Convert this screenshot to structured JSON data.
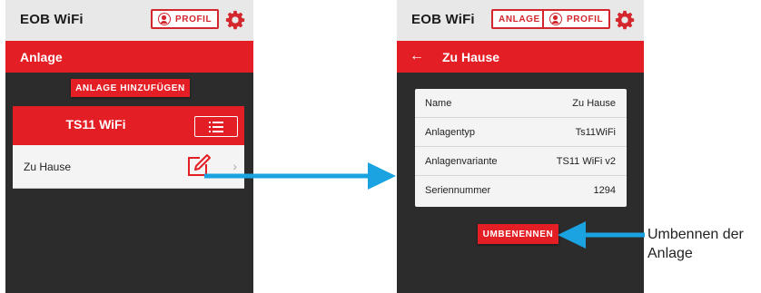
{
  "app_title": "EOB WiFi",
  "profile_label": "PROFIL",
  "anlage_button_label": "ANLAGE",
  "screen1": {
    "section_title": "Anlage",
    "add_button_label": "ANLAGE HINZUFÜGEN",
    "card_title": "TS11 WiFi",
    "row_label": "Zu Hause"
  },
  "screen2": {
    "section_title": "Zu Hause",
    "details": [
      {
        "key": "Name",
        "value": "Zu Hause"
      },
      {
        "key": "Anlagentyp",
        "value": "Ts11WiFi"
      },
      {
        "key": "Anlagenvariante",
        "value": "TS11 WiFi v2"
      },
      {
        "key": "Seriennummer",
        "value": "1294"
      }
    ],
    "rename_button_label": "UMBENENNEN"
  },
  "callout_text": "Umbennen der Anlage",
  "icons": [
    "person-icon",
    "gear-icon",
    "menu-icon",
    "edit-icon",
    "chevron-right-icon",
    "back-arrow-icon",
    "arrow-icon"
  ],
  "colors": {
    "brand_red": "#e31e24",
    "arrow_blue": "#1aa3e0",
    "app_background": "#2c2c2c",
    "header_gray": "#e8e8e8"
  }
}
